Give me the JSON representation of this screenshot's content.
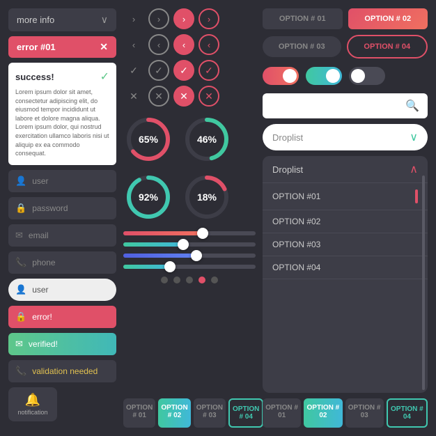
{
  "left": {
    "dropdown_label": "more info",
    "error_label": "error #01",
    "close_x": "✕",
    "success_label": "success!",
    "success_check": "✓",
    "lorem": "Lorem ipsum dolor sit amet, consectetur adipiscing elit, do eiusmod tempor incididunt ut labore et dolore magna aliqua. Lorem ipsum dolor, qui nostrud exercitation ullamco laboris nisi ut aliquip ex ea commodo consequat.",
    "fields": [
      {
        "icon": "👤",
        "label": "user",
        "type": "normal"
      },
      {
        "icon": "🔒",
        "label": "password",
        "type": "normal"
      },
      {
        "icon": "✉",
        "label": "email",
        "type": "normal"
      },
      {
        "icon": "📞",
        "label": "phone",
        "type": "normal"
      }
    ],
    "fields2": [
      {
        "icon": "👤",
        "label": "user",
        "type": "light"
      },
      {
        "icon": "🔒",
        "label": "error!",
        "type": "error"
      },
      {
        "icon": "✉",
        "label": "verified!",
        "type": "verified"
      },
      {
        "icon": "📞",
        "label": "validation needed",
        "type": "validation"
      }
    ],
    "notification_label": "notification"
  },
  "middle": {
    "arrows_right": [
      "›",
      "›",
      "›",
      "›"
    ],
    "arrows_left": [
      "‹",
      "‹",
      "‹",
      "‹"
    ],
    "checks": [
      "✓",
      "✓",
      "✓",
      "✓"
    ],
    "crosses": [
      "✕",
      "✕",
      "✕",
      "✕"
    ],
    "progress_circles": [
      {
        "pct": "65%",
        "value": 65,
        "color": "#e05068"
      },
      {
        "pct": "46%",
        "value": 46,
        "color": "#40c8a0"
      },
      {
        "pct": "92%",
        "value": 92,
        "color": "#40c8b0"
      },
      {
        "pct": "18%",
        "value": 18,
        "color": "#e05068"
      }
    ],
    "sliders": [
      {
        "fill": 60,
        "color": "#e05068"
      },
      {
        "fill": 45,
        "color": "#40c8a0"
      },
      {
        "fill": 55,
        "color": "#5060e0"
      },
      {
        "fill": 35,
        "color": "#40c8a0"
      }
    ],
    "dots": [
      false,
      false,
      false,
      true,
      false
    ],
    "tabs": [
      {
        "label": "OPTION # 01",
        "type": "inactive"
      },
      {
        "label": "OPTION # 02",
        "type": "active-teal"
      },
      {
        "label": "OPTION # 03",
        "type": "inactive"
      },
      {
        "label": "OPTION # 04",
        "type": "active-outline"
      }
    ]
  },
  "right": {
    "top_options": [
      {
        "label": "OPTION # 01",
        "type": "inactive"
      },
      {
        "label": "OPTION # 02",
        "type": "active-pink"
      }
    ],
    "mid_options": [
      {
        "label": "OPTION # 03",
        "type": "inactive-round"
      },
      {
        "label": "OPTION # 04",
        "type": "outline-pink"
      }
    ],
    "toggles": [
      "off",
      "on-teal",
      "off"
    ],
    "search_placeholder": "",
    "droplist_label": "Droplist",
    "droplist_open_label": "Droplist",
    "droplist_items": [
      "OPTION #01",
      "OPTION #02",
      "OPTION #03",
      "OPTION #04"
    ]
  }
}
